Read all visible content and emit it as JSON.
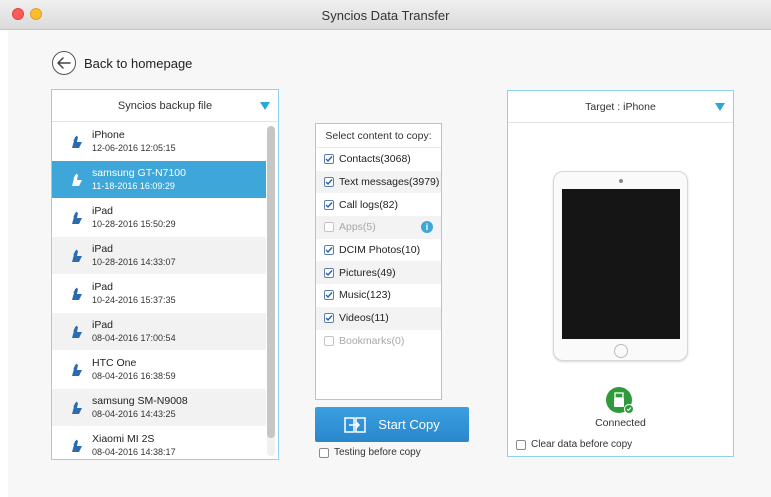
{
  "window": {
    "title": "Syncios Data Transfer"
  },
  "nav": {
    "back_label": "Back to homepage"
  },
  "source": {
    "header": "Syncios backup file",
    "items": [
      {
        "name": "iPhone",
        "date": "12-06-2016 12:05:15",
        "selected": false
      },
      {
        "name": "samsung GT-N7100",
        "date": "11-18-2016 16:09:29",
        "selected": true
      },
      {
        "name": "iPad",
        "date": "10-28-2016 15:50:29",
        "selected": false
      },
      {
        "name": "iPad",
        "date": "10-28-2016 14:33:07",
        "selected": false
      },
      {
        "name": "iPad",
        "date": "10-24-2016 15:37:35",
        "selected": false
      },
      {
        "name": "iPad",
        "date": "08-04-2016 17:00:54",
        "selected": false
      },
      {
        "name": "HTC One",
        "date": "08-04-2016 16:38:59",
        "selected": false
      },
      {
        "name": "samsung SM-N9008",
        "date": "08-04-2016 14:43:25",
        "selected": false
      },
      {
        "name": "Xiaomi MI 2S",
        "date": "08-04-2016 14:38:17",
        "selected": false
      }
    ]
  },
  "content": {
    "header": "Select content to copy:",
    "items": [
      {
        "label": "Contacts(3068)",
        "checked": true,
        "disabled": false
      },
      {
        "label": "Text messages(3979)",
        "checked": true,
        "disabled": false
      },
      {
        "label": "Call logs(82)",
        "checked": true,
        "disabled": false
      },
      {
        "label": "Apps(5)",
        "checked": false,
        "disabled": true,
        "info": true
      },
      {
        "label": "DCIM Photos(10)",
        "checked": true,
        "disabled": false
      },
      {
        "label": "Pictures(49)",
        "checked": true,
        "disabled": false
      },
      {
        "label": "Music(123)",
        "checked": true,
        "disabled": false
      },
      {
        "label": "Videos(11)",
        "checked": true,
        "disabled": false
      },
      {
        "label": "Bookmarks(0)",
        "checked": false,
        "disabled": true
      }
    ]
  },
  "actions": {
    "start_copy": "Start Copy",
    "testing_label": "Testing before copy",
    "testing_checked": false
  },
  "target": {
    "header": "Target : iPhone",
    "status": "Connected",
    "clear_label": "Clear data before copy",
    "clear_checked": false
  },
  "colors": {
    "accent": "#3ea6d9",
    "panel_border": "#8fd2ec",
    "button": "#2f8fd4",
    "connected": "#2f9a3a"
  },
  "icons": {
    "back": "left-arrow-circle-icon",
    "device": "android-device-icon",
    "dropdown": "dropdown-triangle-icon",
    "info": "info-icon",
    "transfer": "transfer-icon",
    "connected": "usb-connected-icon"
  }
}
